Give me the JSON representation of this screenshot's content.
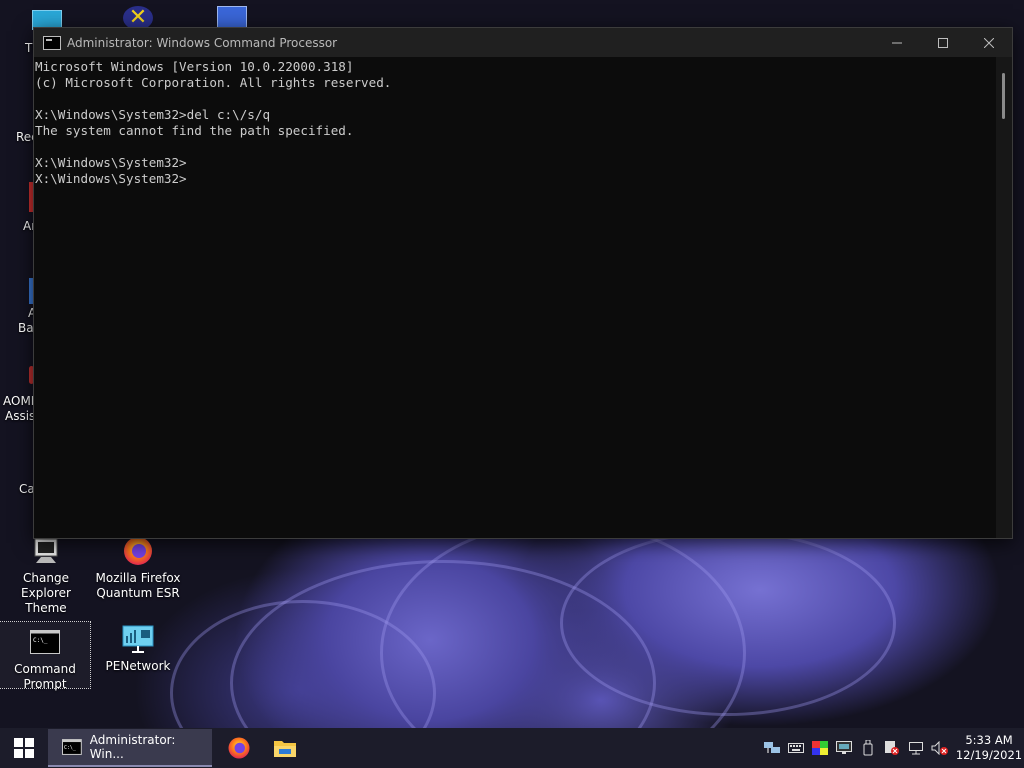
{
  "desktop": {
    "partial_labels": {
      "this_pc": "Th",
      "recycle": "Rec",
      "app1": "Ar",
      "app2_line1": "A",
      "app2_line2": "Bac",
      "aomei_line1": "AOME",
      "aomei_line2": "Assist",
      "ca": "Ca"
    },
    "icons": [
      {
        "line1": "Change Explorer",
        "line2": "Theme"
      },
      {
        "line1": "Mozilla Firefox",
        "line2": "Quantum ESR"
      },
      {
        "line1": "Command",
        "line2": "Prompt"
      },
      {
        "line1": "PENetwork",
        "line2": ""
      }
    ]
  },
  "window": {
    "title": "Administrator: Windows Command Processor",
    "console_lines": [
      "Microsoft Windows [Version 10.0.22000.318]",
      "(c) Microsoft Corporation. All rights reserved.",
      "",
      "X:\\Windows\\System32>del c:\\/s/q",
      "The system cannot find the path specified.",
      "",
      "X:\\Windows\\System32>",
      "X:\\Windows\\System32>"
    ]
  },
  "taskbar": {
    "active_task_label": "Administrator: Win...",
    "clock_time": "5:33 AM",
    "clock_date": "12/19/2021"
  }
}
